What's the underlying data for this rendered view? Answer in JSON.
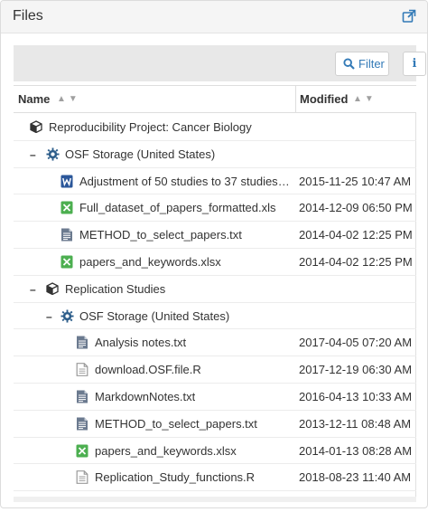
{
  "panel": {
    "title": "Files"
  },
  "toolbar": {
    "filter_label": "Filter",
    "info_label": "i"
  },
  "columns": {
    "name": "Name",
    "modified": "Modified"
  },
  "colors": {
    "link": "#337ab7",
    "word": "#2b579a",
    "excel": "#4caf50",
    "text_file": "#6b7a8f",
    "generic": "#999999"
  },
  "rows": [
    {
      "level": 0,
      "toggle": "",
      "icon": "project-icon",
      "name": "Reproducibility Project: Cancer Biology",
      "modified": ""
    },
    {
      "level": 1,
      "toggle": "–",
      "icon": "storage-gear-icon",
      "name": "OSF Storage (United States)",
      "modified": ""
    },
    {
      "level": 2,
      "toggle": "",
      "icon": "word-file-icon",
      "name": "Adjustment of 50 studies to 37 studies.d...",
      "modified": "2015-11-25 10:47 AM"
    },
    {
      "level": 2,
      "toggle": "",
      "icon": "excel-file-icon",
      "name": "Full_dataset_of_papers_formatted.xls",
      "modified": "2014-12-09 06:50 PM"
    },
    {
      "level": 2,
      "toggle": "",
      "icon": "text-file-icon",
      "name": "METHOD_to_select_papers.txt",
      "modified": "2014-04-02 12:25 PM"
    },
    {
      "level": 2,
      "toggle": "",
      "icon": "excel-file-icon",
      "name": "papers_and_keywords.xlsx",
      "modified": "2014-04-02 12:25 PM"
    },
    {
      "level": 1,
      "toggle": "–",
      "icon": "project-icon",
      "name": "Replication Studies",
      "modified": ""
    },
    {
      "level": 2,
      "toggle": "–",
      "icon": "storage-gear-icon",
      "name": "OSF Storage (United States)",
      "modified": ""
    },
    {
      "level": 3,
      "toggle": "",
      "icon": "text-file-icon",
      "name": "Analysis notes.txt",
      "modified": "2017-04-05 07:20 AM"
    },
    {
      "level": 3,
      "toggle": "",
      "icon": "generic-file-icon",
      "name": "download.OSF.file.R",
      "modified": "2017-12-19 06:30 AM"
    },
    {
      "level": 3,
      "toggle": "",
      "icon": "text-file-icon",
      "name": "MarkdownNotes.txt",
      "modified": "2016-04-13 10:33 AM"
    },
    {
      "level": 3,
      "toggle": "",
      "icon": "text-file-icon",
      "name": "METHOD_to_select_papers.txt",
      "modified": "2013-12-11 08:48 AM"
    },
    {
      "level": 3,
      "toggle": "",
      "icon": "excel-file-icon",
      "name": "papers_and_keywords.xlsx",
      "modified": "2014-01-13 08:28 AM"
    },
    {
      "level": 3,
      "toggle": "",
      "icon": "generic-file-icon",
      "name": "Replication_Study_functions.R",
      "modified": "2018-08-23 11:40 AM"
    }
  ]
}
